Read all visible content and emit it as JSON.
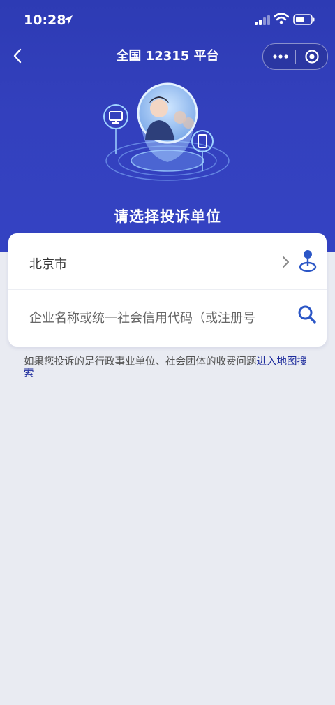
{
  "status_bar": {
    "time": "10:28"
  },
  "nav": {
    "title": "全国 12315 平台"
  },
  "hero": {
    "heading": "请选择投诉单位"
  },
  "form": {
    "city_value": "北京市",
    "search_placeholder": "企业名称或统一社会信用代码（或注册号"
  },
  "note": {
    "text": "如果您投诉的是行政事业单位、社会团体的收费问题",
    "link": "进入地图搜索"
  },
  "colors": {
    "primary": "#3340bd",
    "link": "#1d2b9c",
    "accent": "#2b56c6"
  }
}
